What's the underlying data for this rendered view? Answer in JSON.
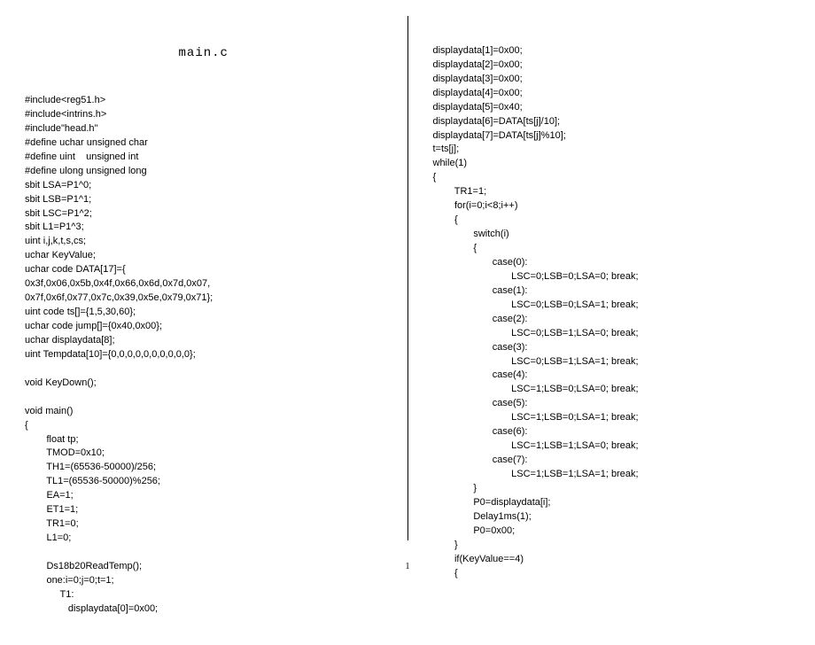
{
  "title": "main.c",
  "pageNumber": "1",
  "left": "#include<reg51.h>\n#include<intrins.h>\n#include\"head.h\"\n#define uchar unsigned char\n#define uint    unsigned int\n#define ulong unsigned long\nsbit LSA=P1^0;\nsbit LSB=P1^1;\nsbit LSC=P1^2;\nsbit L1=P1^3;\nuint i,j,k,t,s,cs;\nuchar KeyValue;\nuchar code DATA[17]={\n0x3f,0x06,0x5b,0x4f,0x66,0x6d,0x7d,0x07,\n0x7f,0x6f,0x77,0x7c,0x39,0x5e,0x79,0x71};\nuint code ts[]={1,5,30,60};\nuchar code jump[]={0x40,0x00};\nuchar displaydata[8];\nuint Tempdata[10]={0,0,0,0,0,0,0,0,0,0};\n\nvoid KeyDown();\n\nvoid main()\n{\n        float tp;\n        TMOD=0x10;\n        TH1=(65536-50000)/256;\n        TL1=(65536-50000)%256;\n        EA=1;\n        ET1=1;\n        TR1=0;\n        L1=0;\n\n        Ds18b20ReadTemp();\n        one:i=0;j=0;t=1;\n             T1:\n                displaydata[0]=0x00;",
  "right": "displaydata[1]=0x00;\ndisplaydata[2]=0x00;\ndisplaydata[3]=0x00;\ndisplaydata[4]=0x00;\ndisplaydata[5]=0x40;\ndisplaydata[6]=DATA[ts[j]/10];\ndisplaydata[7]=DATA[ts[j]%10];\nt=ts[j];\nwhile(1)\n{\n        TR1=1;\n        for(i=0;i<8;i++)\n        {\n               switch(i)\n               {\n                      case(0):\n                             LSC=0;LSB=0;LSA=0; break;\n                      case(1):\n                             LSC=0;LSB=0;LSA=1; break;\n                      case(2):\n                             LSC=0;LSB=1;LSA=0; break;\n                      case(3):\n                             LSC=0;LSB=1;LSA=1; break;\n                      case(4):\n                             LSC=1;LSB=0;LSA=0; break;\n                      case(5):\n                             LSC=1;LSB=0;LSA=1; break;\n                      case(6):\n                             LSC=1;LSB=1;LSA=0; break;\n                      case(7):\n                             LSC=1;LSB=1;LSA=1; break;\n               }\n               P0=displaydata[i];\n               Delay1ms(1);\n               P0=0x00;\n        }\n        if(KeyValue==4)\n        {"
}
